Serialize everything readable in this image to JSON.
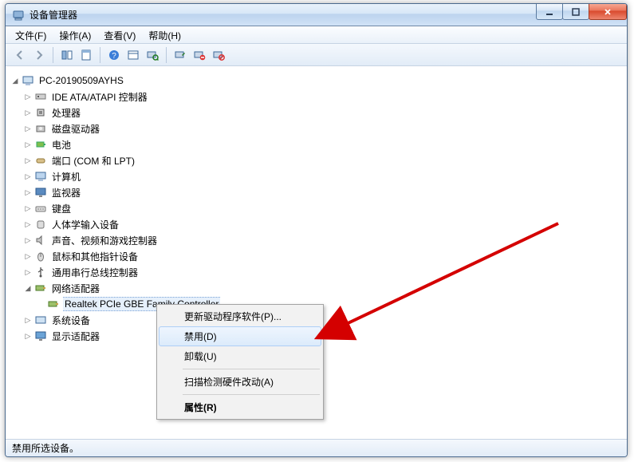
{
  "title": "设备管理器",
  "menu": {
    "file": "文件(F)",
    "action": "操作(A)",
    "view": "查看(V)",
    "help": "帮助(H)"
  },
  "root": "PC-20190509AYHS",
  "nodes": {
    "ide": "IDE ATA/ATAPI 控制器",
    "cpu": "处理器",
    "disk": "磁盘驱动器",
    "battery": "电池",
    "ports": "端口 (COM 和 LPT)",
    "computer": "计算机",
    "monitor": "监视器",
    "keyboard": "键盘",
    "hid": "人体学输入设备",
    "sound": "声音、视频和游戏控制器",
    "mouse": "鼠标和其他指针设备",
    "usb": "通用串行总线控制器",
    "net": "网络适配器",
    "nic": "Realtek PCIe GBE Family Controller",
    "system": "系统设备",
    "display": "显示适配器"
  },
  "ctx": {
    "update": "更新驱动程序软件(P)...",
    "disable": "禁用(D)",
    "uninstall": "卸载(U)",
    "scan": "扫描检测硬件改动(A)",
    "properties": "属性(R)"
  },
  "status": "禁用所选设备。"
}
